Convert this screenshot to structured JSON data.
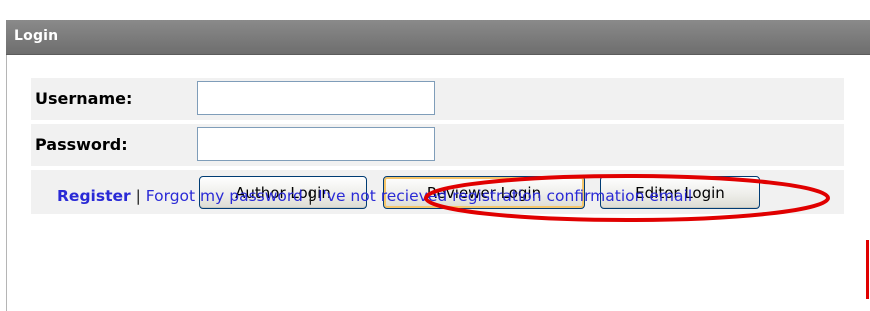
{
  "login": {
    "title": "Login",
    "username_label": "Username:",
    "password_label": "Password:",
    "username_value": "",
    "password_value": "",
    "buttons": {
      "author": "Author Login",
      "reviewer": "Reviewer Login",
      "editor": "Editor Login"
    },
    "links": {
      "register": "Register",
      "forgot": "Forgot my password",
      "not_received": "I've not recieved registration confirmation email",
      "separator": "|"
    }
  },
  "colors": {
    "titlebar": "#6e6e6e",
    "link": "#2a2ad6",
    "annotation": "#e00000"
  }
}
